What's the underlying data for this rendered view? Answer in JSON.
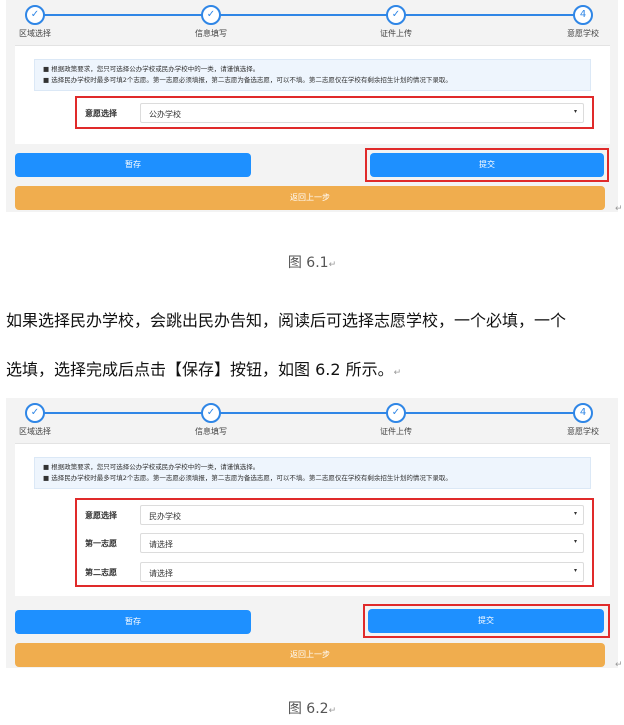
{
  "steps": [
    "区域选择",
    "信息填写",
    "证件上传",
    "意愿学校"
  ],
  "last_step_number": "4",
  "notice": {
    "line1": "■ 根据政策要求，您只可选择公办学校或民办学校中的一类，请谨慎选择。",
    "line2": "■ 选择民办学校时最多可填2个志愿。第一志愿必须填报，第二志愿为备选志愿，可以不填。第二志愿仅在学校有剩余招生计划的情况下录取。"
  },
  "figure1": {
    "willingness_label": "意愿选择",
    "willingness_value": "公办学校",
    "save_label": "暂存",
    "submit_label": "提交",
    "back_label": "返回上一步",
    "caption": "图 6.1"
  },
  "paragraph": {
    "line1": "如果选择民办学校，会跳出民办告知，阅读后可选择志愿学校，一个必填，一个",
    "line2": "选填，选择完成后点击【保存】按钮，如图 6.2 所示。"
  },
  "figure2": {
    "willingness_label": "意愿选择",
    "willingness_value": "民办学校",
    "first_choice_label": "第一志愿",
    "first_choice_value": "请选择",
    "second_choice_label": "第二志愿",
    "second_choice_value": "请选择",
    "save_label": "暂存",
    "submit_label": "提交",
    "back_label": "返回上一步",
    "caption": "图 6.2"
  },
  "marks": {
    "arrow_glyph": "▾",
    "para_mark": "↵"
  }
}
